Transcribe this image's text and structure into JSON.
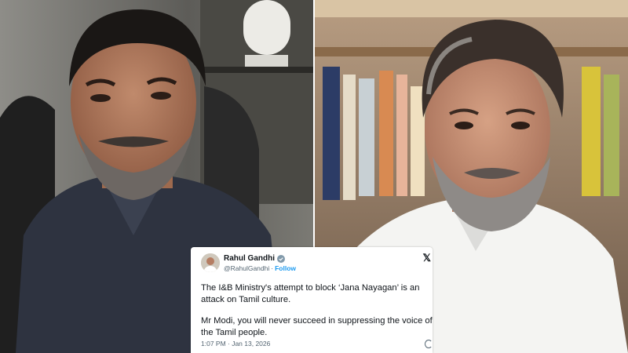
{
  "tweet": {
    "author_name": "Rahul Gandhi",
    "handle": "@RahulGandhi",
    "separator": "·",
    "follow_label": "Follow",
    "platform_glyph": "𝕏",
    "paragraph_1": "The I&B Ministry's attempt to block ‘Jana Nayagan’ is an attack on Tamil culture.",
    "paragraph_2": "Mr Modi, you will never succeed in suppressing the voice of the Tamil people.",
    "timestamp": "1:07 PM · Jan 13, 2026",
    "accent_color": "#1d9bf0",
    "verified_icon": "verified-badge-icon",
    "info_icon": "info-icon"
  }
}
